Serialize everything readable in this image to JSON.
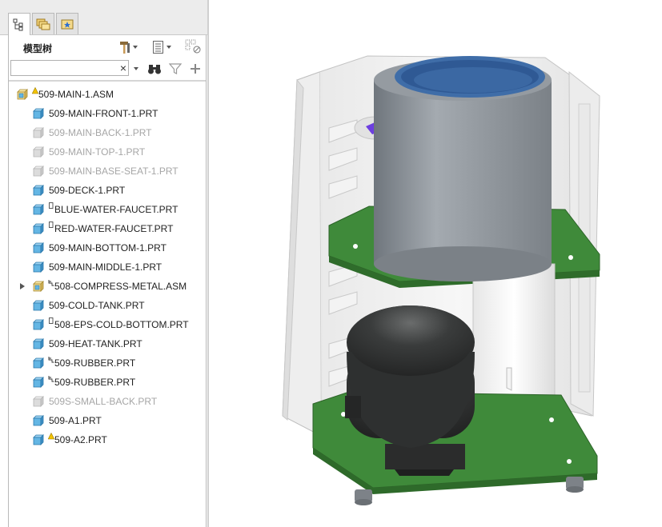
{
  "tabs": [
    {
      "name": "model-tree",
      "icon": "model-tree-icon"
    },
    {
      "name": "folder-browser",
      "icon": "folder-browser-icon"
    },
    {
      "name": "favorites",
      "icon": "favorites-icon"
    }
  ],
  "tree_panel": {
    "title": "模型树",
    "toolbar": {
      "settings_icon": "hammer-settings-icon",
      "show_icon": "list-show-icon",
      "filter_toggle_icon": "tree-filter-icon"
    },
    "search": {
      "value": "",
      "placeholder": ""
    },
    "search_tools": {
      "find_icon": "binoculars-icon",
      "filter_icon": "funnel-filter-icon",
      "add_icon": "plus-icon"
    },
    "items": [
      {
        "label": "509-MAIN-1.ASM",
        "type": "assembly",
        "state": "normal",
        "marker": "warning",
        "level": 0
      },
      {
        "label": "509-MAIN-FRONT-1.PRT",
        "type": "part",
        "state": "normal",
        "marker": "",
        "level": 1
      },
      {
        "label": "509-MAIN-BACK-1.PRT",
        "type": "part",
        "state": "suppressed",
        "marker": "",
        "level": 1
      },
      {
        "label": "509-MAIN-TOP-1.PRT",
        "type": "part",
        "state": "suppressed",
        "marker": "",
        "level": 1
      },
      {
        "label": "509-MAIN-BASE-SEAT-1.PRT",
        "type": "part",
        "state": "suppressed",
        "marker": "",
        "level": 1
      },
      {
        "label": "509-DECK-1.PRT",
        "type": "part",
        "state": "normal",
        "marker": "",
        "level": 1
      },
      {
        "label": "BLUE-WATER-FAUCET.PRT",
        "type": "part",
        "state": "normal",
        "marker": "box",
        "level": 1
      },
      {
        "label": "RED-WATER-FAUCET.PRT",
        "type": "part",
        "state": "normal",
        "marker": "box",
        "level": 1
      },
      {
        "label": "509-MAIN-BOTTOM-1.PRT",
        "type": "part",
        "state": "normal",
        "marker": "",
        "level": 1
      },
      {
        "label": "509-MAIN-MIDDLE-1.PRT",
        "type": "part",
        "state": "normal",
        "marker": "",
        "level": 1
      },
      {
        "label": "508-COMPRESS-METAL.ASM",
        "type": "assembly",
        "state": "normal",
        "marker": "packaged",
        "level": 1,
        "expandable": true
      },
      {
        "label": "509-COLD-TANK.PRT",
        "type": "part",
        "state": "normal",
        "marker": "",
        "level": 1
      },
      {
        "label": "508-EPS-COLD-BOTTOM.PRT",
        "type": "part",
        "state": "normal",
        "marker": "box",
        "level": 1
      },
      {
        "label": "509-HEAT-TANK.PRT",
        "type": "part",
        "state": "normal",
        "marker": "",
        "level": 1
      },
      {
        "label": "509-RUBBER.PRT",
        "type": "part",
        "state": "normal",
        "marker": "packaged",
        "level": 1
      },
      {
        "label": "509-RUBBER.PRT",
        "type": "part",
        "state": "normal",
        "marker": "packaged",
        "level": 1
      },
      {
        "label": "509S-SMALL-BACK.PRT",
        "type": "part",
        "state": "suppressed",
        "marker": "",
        "level": 1
      },
      {
        "label": "509-A1.PRT",
        "type": "part",
        "state": "normal",
        "marker": "",
        "level": 1
      },
      {
        "label": "509-A2.PRT",
        "type": "part",
        "state": "normal",
        "marker": "warning",
        "level": 1
      }
    ]
  },
  "graphics": {
    "model": "water-dispenser-assembly-render",
    "colors": {
      "deck_green": "#3f8a3a",
      "tank_gray": "#8c9298",
      "tank_blue": "#3f6da8",
      "compressor_black": "#2f3030",
      "housing_white": "#efefef"
    }
  }
}
